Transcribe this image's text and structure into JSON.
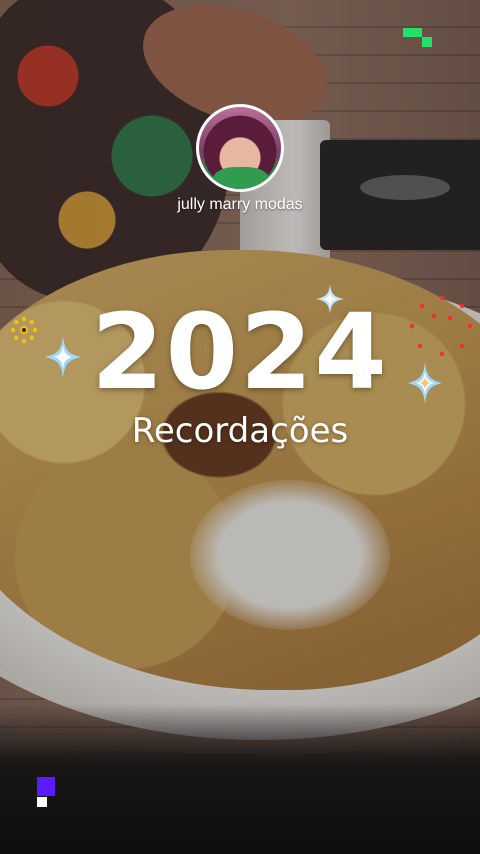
{
  "profile": {
    "avatar_icon": "profile-photo",
    "username": "jully marry modas"
  },
  "recap": {
    "year": "2024",
    "subtitle": "Recordações"
  },
  "decorations": {
    "sparkle_color": "#ffffff",
    "sparkle_glow": "#9fd8ff",
    "ring_color": "#f2c300",
    "firework_color": "#ff2a2a",
    "pixel_green": "#22e06a",
    "pixel_purple": "#5a1bff",
    "pixel_white": "#ffffff"
  }
}
